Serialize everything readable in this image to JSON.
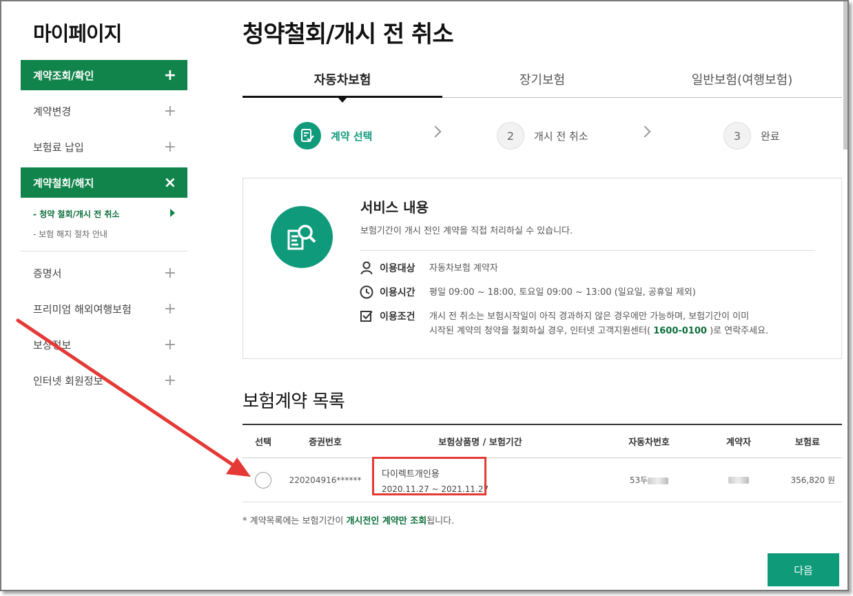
{
  "sidebar": {
    "title": "마이페이지",
    "menu": [
      {
        "label": "계약조회/확인",
        "sign": "+"
      },
      {
        "label": "계약변경",
        "sign": "+"
      },
      {
        "label": "보험료 납입",
        "sign": "+"
      },
      {
        "label": "계약철회/해지",
        "sign": "×"
      },
      {
        "label": "증명서",
        "sign": "+"
      },
      {
        "label": "프리미엄 해외여행보험",
        "sign": "+"
      },
      {
        "label": "보상정보",
        "sign": "+"
      },
      {
        "label": "인터넷 회원정보",
        "sign": "+"
      }
    ],
    "sub_items": [
      "- 청약 철회/개시 전 취소",
      "- 보험 해지 절차 안내"
    ]
  },
  "page_title": "청약철회/개시 전 취소",
  "tabs": [
    "자동차보험",
    "장기보험",
    "일반보험(여행보험)"
  ],
  "steps": [
    {
      "num": "",
      "label": "계약 선택"
    },
    {
      "num": "2",
      "label": "개시 전 취소"
    },
    {
      "num": "3",
      "label": "완료"
    }
  ],
  "service": {
    "title": "서비스 내용",
    "desc": "보험기간이 개시 전인 계약을 직접 처리하실 수 있습니다.",
    "target_label": "이용대상",
    "target_value": "자동차보험 계약자",
    "time_label": "이용시간",
    "time_value": "평일 09:00 ~ 18:00, 토요일 09:00 ~ 13:00 (일요일, 공휴일 제외)",
    "cond_label": "이용조건",
    "cond_value_1": "개시 전 취소는 보험시작일이 아직 경과하지 않은 경우에만 가능하며, 보험기간이 이미",
    "cond_value_2a": "시작된 계약의 청약을 철회하실 경우, 인터넷 고객지원센터(",
    "cond_phone": "1600-0100",
    "cond_value_2b": ")로 연락주세요."
  },
  "list": {
    "title": "보험계약 목록",
    "headers": [
      "선택",
      "증권번호",
      "보험상품명 / 보험기간",
      "자동차번호",
      "계약자",
      "보험료"
    ],
    "rows": [
      {
        "policy_no": "220204916******",
        "product": "다이렉트개인용",
        "period": "2020.11.27 ~ 2021.11.27",
        "car_no": "53두",
        "premium": "356,820 원"
      }
    ]
  },
  "note": {
    "prefix": "* 계약목록에는 보험기간이 ",
    "highlight": "개시전인 계약만 조회",
    "suffix": "됩니다."
  },
  "next_button": "다음",
  "colors": {
    "brand_green": "#11844b",
    "accent_teal": "#109a7c",
    "annotation_red": "#e53935"
  }
}
